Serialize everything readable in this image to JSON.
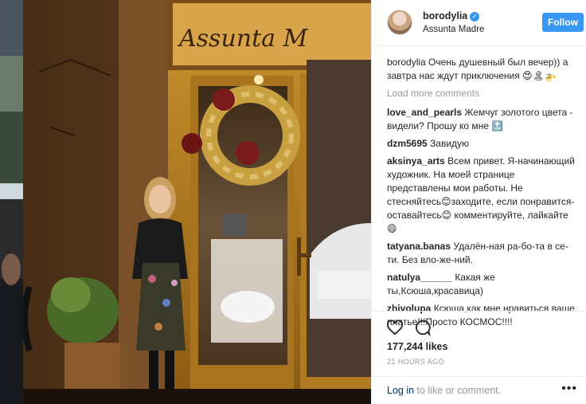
{
  "post": {
    "username": "borodylia",
    "location": "Assunta Madre",
    "follow_label": "Follow",
    "sign_text": "Assunta  M",
    "caption_user": "borodylia",
    "caption_text": "Очень душевный был вечер)) а завтра нас ждут приключения 😍🏝🚁",
    "load_more": "Load more comments",
    "comments": [
      {
        "user": "love_and_pearls",
        "text": "Жемчуг золотого цвета - видели? Прошу ко мне 🔝"
      },
      {
        "user": "dzm5695",
        "text": "Завидую"
      },
      {
        "user": "aksinya_arts",
        "text": "Всем привет. Я-начинающий художник. На моей странице представлены мои работы. Не стесняйтесь😊заходите, если понравится-оставайтесь😊 комментируйте, лайкайте😄"
      },
      {
        "user": "tatyana.banas",
        "text": "Удалён-ная ра-бо-та в се-ти. Без вло-же-ний."
      },
      {
        "user": "natulya______",
        "text": "Какая же ты,Ксюша,красавица)"
      },
      {
        "user": "zhivolupa",
        "text": "Ксюша,как мне нравиться ваше платье!!!Просто КОСМОС!!!!"
      }
    ],
    "likes": "177,244 likes",
    "time_ago": "21 HOURS AGO",
    "login_link": "Log in",
    "login_rest": " to like or comment.",
    "more": "•••"
  },
  "icons": [
    "heart-icon",
    "comment-icon",
    "verified-icon",
    "more-options-icon"
  ],
  "colors": {
    "accent": "#3897f0",
    "muted": "#999999",
    "link": "#003569"
  }
}
